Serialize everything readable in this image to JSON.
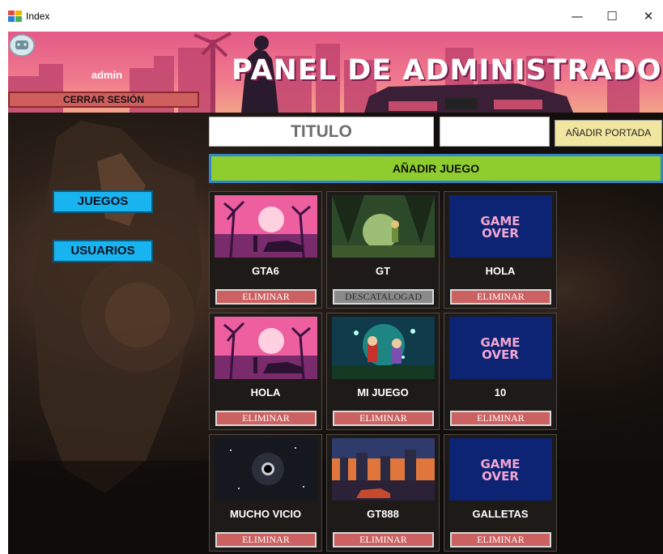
{
  "window": {
    "title": "Index",
    "minimize": "—",
    "maximize": "☐",
    "close": "✕"
  },
  "header": {
    "username": "admin",
    "logout_label": "CERRAR SESIÓN",
    "panel_title": "PANEL DE ADMINISTRADOR"
  },
  "nav": {
    "games_label": "JUEGOS",
    "users_label": "USUARIOS"
  },
  "form": {
    "title_value": "TITULO",
    "cover_value": "",
    "add_cover_label": "AÑADIR PORTADA",
    "add_game_label": "AÑADIR JUEGO"
  },
  "colors": {
    "nav_button": "#18b4ef",
    "add_game_button": "#8fcd2f",
    "delete_button": "#cc6161",
    "discontinued_button": "#8a8a8a",
    "add_cover_button": "#f1e6a0"
  },
  "games": [
    {
      "name": "GTA6",
      "image": "sunset-car",
      "action": "ELIMINAR"
    },
    {
      "name": "GT",
      "image": "forest-elf",
      "action": "DESCATALOGAD"
    },
    {
      "name": "HOLA",
      "image": "game-over",
      "action": "ELIMINAR"
    },
    {
      "name": "HOLA",
      "image": "sunset-car",
      "action": "ELIMINAR"
    },
    {
      "name": "MI JUEGO",
      "image": "forest-heroes",
      "action": "ELIMINAR"
    },
    {
      "name": "10",
      "image": "game-over",
      "action": "ELIMINAR"
    },
    {
      "name": "MUCHO VICIO",
      "image": "space-blackhole",
      "action": "ELIMINAR"
    },
    {
      "name": "GT888",
      "image": "city-night",
      "action": "ELIMINAR"
    },
    {
      "name": "GALLETAS",
      "image": "game-over",
      "action": "ELIMINAR"
    }
  ],
  "game_over_text": [
    "GAME",
    "OVER"
  ]
}
